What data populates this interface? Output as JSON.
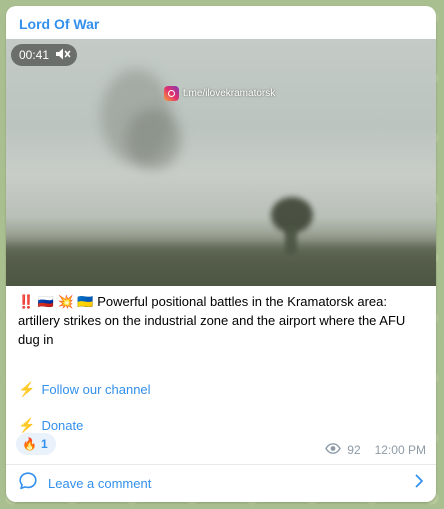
{
  "channel": {
    "title": "Lord Of War"
  },
  "video": {
    "duration": "00:41",
    "watermark": "t.me/ilovekramatorsk",
    "muted": true
  },
  "post": {
    "prefix_emoji": "‼️ 🇷🇺 💥 🇺🇦",
    "text": "Powerful positional battles in the Kramatorsk area: artillery strikes on the industrial zone and the airport where the AFU dug in"
  },
  "links": [
    {
      "icon": "⚡",
      "label": "Follow our channel"
    },
    {
      "icon": "⚡",
      "label": "Donate"
    }
  ],
  "reaction": {
    "emoji": "🔥",
    "count": "1"
  },
  "meta": {
    "views": "92",
    "time": "12:00 PM"
  },
  "comments": {
    "label": "Leave a comment"
  },
  "colors": {
    "accent": "#3390ec",
    "meta": "#8e9ba7",
    "background": "#a9bf8f"
  }
}
